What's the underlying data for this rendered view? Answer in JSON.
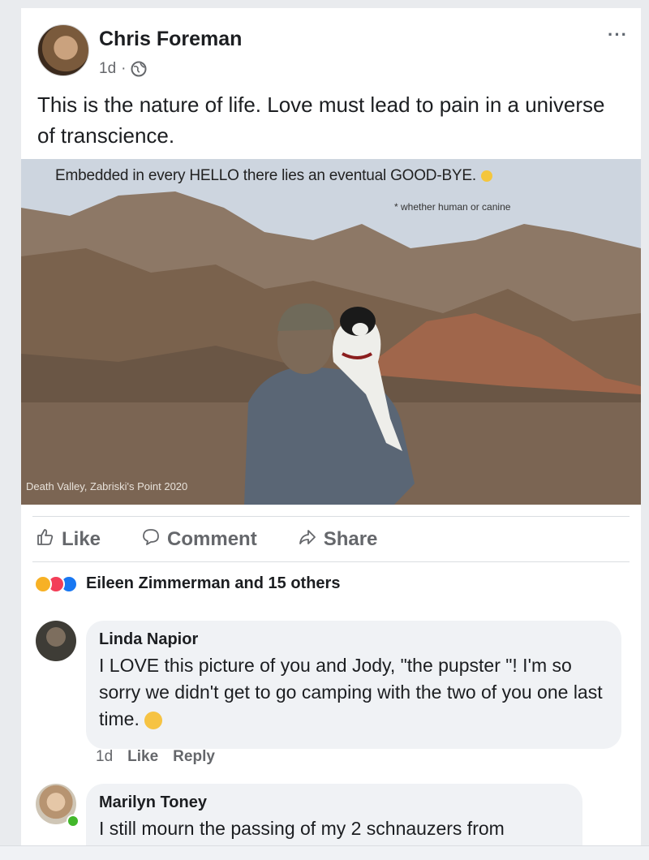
{
  "post": {
    "author": "Chris Foreman",
    "time": "1d",
    "separator": "·",
    "more": "···",
    "text": "This is the nature of life. Love must lead to pain in a universe of transcience."
  },
  "image": {
    "headline": "Embedded in every HELLO there lies an eventual GOOD-BYE.",
    "subtitle": "* whether human or canine",
    "caption": "Death Valley, Zabriski's Point 2020"
  },
  "actions": {
    "like": "Like",
    "comment": "Comment",
    "share": "Share"
  },
  "reactions": {
    "summary": "Eileen Zimmerman and 15 others",
    "types": [
      "wow",
      "love",
      "like"
    ]
  },
  "comments": [
    {
      "name": "Linda Napior",
      "text": "I LOVE this picture of you and Jody, \"the pupster \"! I'm so sorry we didn't get to go camping with the two of you one last time.",
      "time": "1d",
      "like": "Like",
      "reply": "Reply"
    },
    {
      "name": "Marilyn Toney",
      "text": "I still mourn the passing of my 2 schnauzers from"
    }
  ],
  "colors": {
    "accent": "#1877f2",
    "secondary_text": "#65676b",
    "bubble": "#f0f2f5"
  }
}
